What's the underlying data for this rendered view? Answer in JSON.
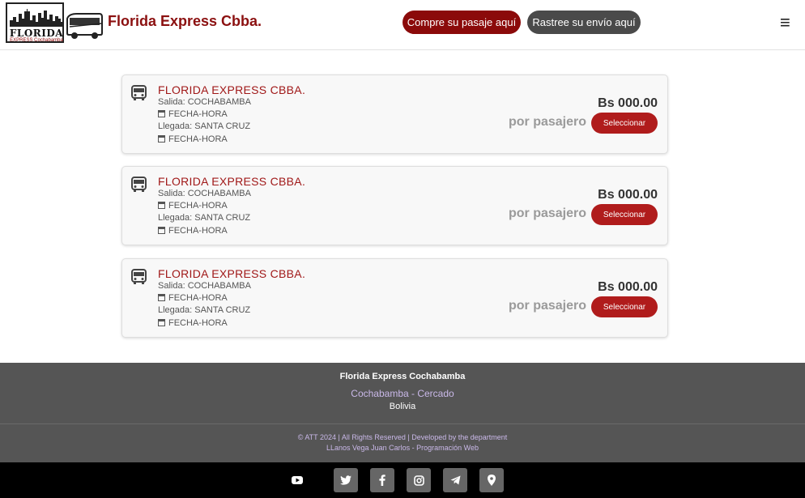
{
  "header": {
    "logo_text": "FLORIDA",
    "logo_sub": "EXPRESS Cochabamba",
    "title": "Florida Express Cbba.",
    "buy_label": "Compre su pasaje aquí",
    "track_label": "Rastree su envío aquí",
    "menu_icon": "≡"
  },
  "colors": {
    "brand": "#8b1010",
    "button_red": "#b01c1c",
    "track_gray": "#4a4a4a",
    "footer_bg": "#555555"
  },
  "trips": [
    {
      "company": "FLORIDA EXPRESS CBBA.",
      "departure": "Salida: COCHABAMBA",
      "departure_time": "FECHA-HORA",
      "arrival": "Llegada: SANTA CRUZ",
      "arrival_time": "FECHA-HORA",
      "price": "Bs 000.00",
      "per": "por pasajero",
      "select_label": "Seleccionar"
    },
    {
      "company": "FLORIDA EXPRESS CBBA.",
      "departure": "Salida: COCHABAMBA",
      "departure_time": "FECHA-HORA",
      "arrival": "Llegada: SANTA CRUZ",
      "arrival_time": "FECHA-HORA",
      "price": "Bs 000.00",
      "per": "por pasajero",
      "select_label": "Seleccionar"
    },
    {
      "company": "FLORIDA EXPRESS CBBA.",
      "departure": "Salida: COCHABAMBA",
      "departure_time": "FECHA-HORA",
      "arrival": "Llegada: SANTA CRUZ",
      "arrival_time": "FECHA-HORA",
      "price": "Bs 000.00",
      "per": "por pasajero",
      "select_label": "Seleccionar"
    }
  ],
  "footer": {
    "title": "Florida Express Cochabamba",
    "city": "Cochabamba - Cercado",
    "country": "Bolivia",
    "copyright": "© ATT 2024 | All Rights Reserved | Developed by the department",
    "developer": "LLanos Vega Juan Carlos - Programación Web"
  },
  "social": [
    "youtube-icon",
    "twitter-icon",
    "facebook-icon",
    "instagram-icon",
    "telegram-icon",
    "map-pin-icon"
  ]
}
